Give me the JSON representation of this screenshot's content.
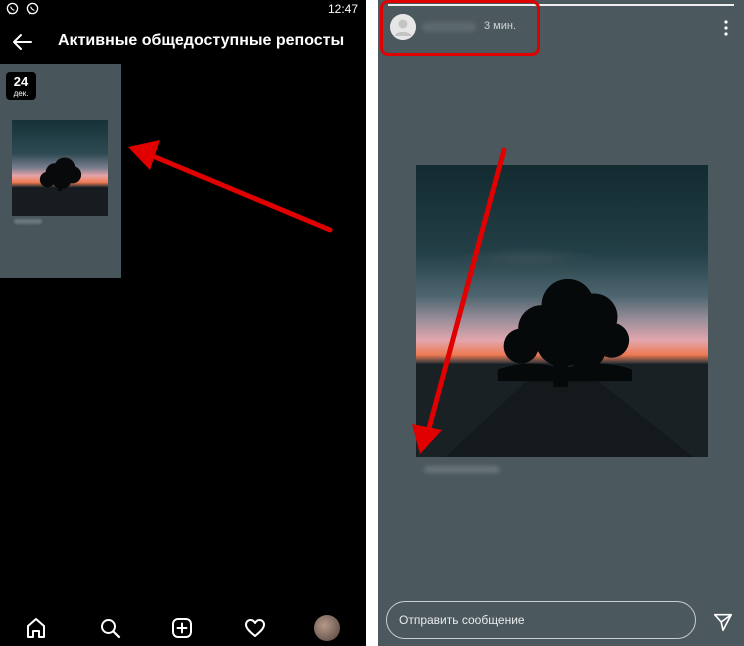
{
  "status_bar": {
    "time": "12:47",
    "icons": [
      "viber-icon",
      "viber-icon"
    ]
  },
  "left_screen": {
    "title": "Активные общедоступные репосты",
    "back_icon": "arrow-left-icon",
    "archive_card": {
      "day": "24",
      "month": "дек."
    },
    "bottom_nav": [
      "home-icon",
      "search-icon",
      "add-post-icon",
      "heart-icon",
      "profile-avatar"
    ]
  },
  "right_screen": {
    "story_time": "3 мин.",
    "menu_icon": "more-vertical-icon",
    "reply_placeholder": "Отправить сообщение",
    "send_icon": "paper-plane-icon"
  },
  "annotations": {
    "color": "#e00000"
  },
  "colors": {
    "left_background": "#000000",
    "story_background": "#4b585d",
    "card_background": "#48565b"
  }
}
